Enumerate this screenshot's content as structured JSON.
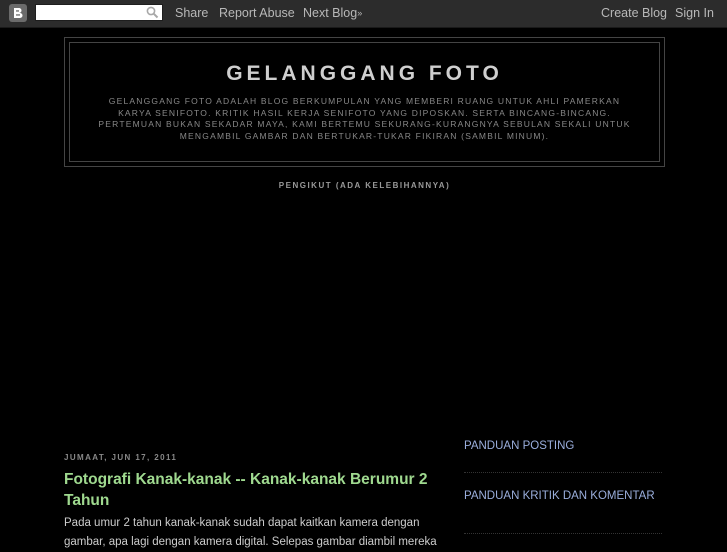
{
  "navbar": {
    "logo_icon": "blogger-logo-icon",
    "search": {
      "value": "",
      "placeholder": "",
      "icon": "search-icon"
    },
    "links": {
      "share": "Share",
      "report_abuse": "Report Abuse",
      "next_blog": "Next Blog",
      "next_blog_glyph": "»",
      "create_blog": "Create Blog",
      "sign_in": "Sign In"
    }
  },
  "header": {
    "title": "GELANGGANG FOTO",
    "description": "GELANGGANG FOTO ADALAH BLOG BERKUMPULAN YANG MEMBERI RUANG UNTUK AHLI PAMERKAN KARYA SENIFOTO. KRITIK HASIL KERJA SENIFOTO YANG DIPOSKAN. SERTA BINCANG-BINCANG. PERTEMUAN BUKAN SEKADAR MAYA, KAMI BERTEMU SEKURANG-KURANGNYA SEBULAN SEKALI UNTUK MENGAMBIL GAMBAR DAN BERTUKAR-TUKAR FIKIRAN (SAMBIL MINUM)."
  },
  "followers": {
    "title": "PENGIKUT (ADA KELEBIHANNYA)"
  },
  "post": {
    "date": "JUMAAT, JUN 17, 2011",
    "title": "Fotografi Kanak-kanak -- Kanak-kanak Berumur 2 Tahun",
    "body": "Pada umur 2 tahun kanak-kanak sudah dapat kaitkan kamera dengan gambar, apa lagi dengan kamera digital.  Selepas gambar diambil mereka"
  },
  "sidebar": {
    "links": [
      {
        "label": "PANDUAN POSTING"
      },
      {
        "label": "PANDUAN KRITIK DAN KOMENTAR"
      }
    ]
  },
  "colors": {
    "background": "#000000",
    "navbar": "#2c2c2c",
    "post_title": "#9fd98f",
    "sidebar_link": "#9aaedc"
  }
}
